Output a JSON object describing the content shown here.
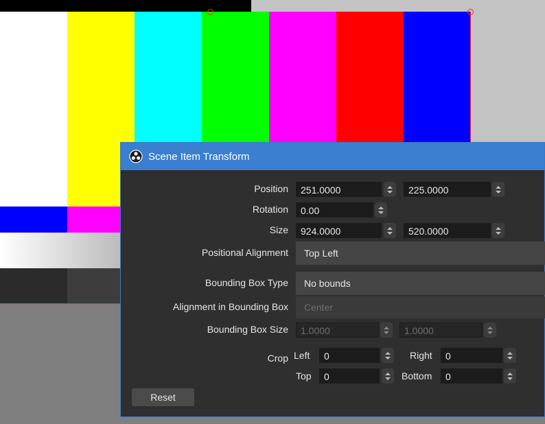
{
  "window": {
    "title": "Scene Item Transform",
    "icon": "obs-logo-icon"
  },
  "colors": {
    "titlebar": "#3b7fd0",
    "dialog_bg": "#2f2f2f",
    "selection_border": "#ff2a2a",
    "test_bars": [
      "#ffffff",
      "#ffff00",
      "#00ffff",
      "#00ff00",
      "#ff00ff",
      "#ff0000",
      "#0000ff"
    ],
    "mid_bars": [
      "#0000ff",
      "#ff00ff",
      "#ffff00",
      "#ffffff",
      "#ffffff",
      "#ffffff",
      "#ffffff"
    ],
    "gray_steps": [
      "#2b2b2b",
      "#3d3d3d",
      "#4c4c4c",
      "#5b5b5b",
      "#6c6c6c",
      "#7d7d7d",
      "#8e8e8e"
    ]
  },
  "labels": {
    "position": "Position",
    "rotation": "Rotation",
    "size": "Size",
    "positional_alignment": "Positional Alignment",
    "bounding_box_type": "Bounding Box Type",
    "alignment_in_bounding_box": "Alignment in Bounding Box",
    "bounding_box_size": "Bounding Box Size",
    "crop": "Crop",
    "crop_left": "Left",
    "crop_right": "Right",
    "crop_top": "Top",
    "crop_bottom": "Bottom"
  },
  "fields": {
    "position_x": "251.0000",
    "position_y": "225.0000",
    "rotation": "0.00",
    "size_w": "924.0000",
    "size_h": "520.0000",
    "positional_alignment": "Top Left",
    "bounding_box_type": "No bounds",
    "alignment_in_bounding_box": "Center",
    "bounding_box_w": "1.0000",
    "bounding_box_h": "1.0000",
    "crop_left": "0",
    "crop_right": "0",
    "crop_top": "0",
    "crop_bottom": "0"
  },
  "buttons": {
    "reset": "Reset"
  }
}
